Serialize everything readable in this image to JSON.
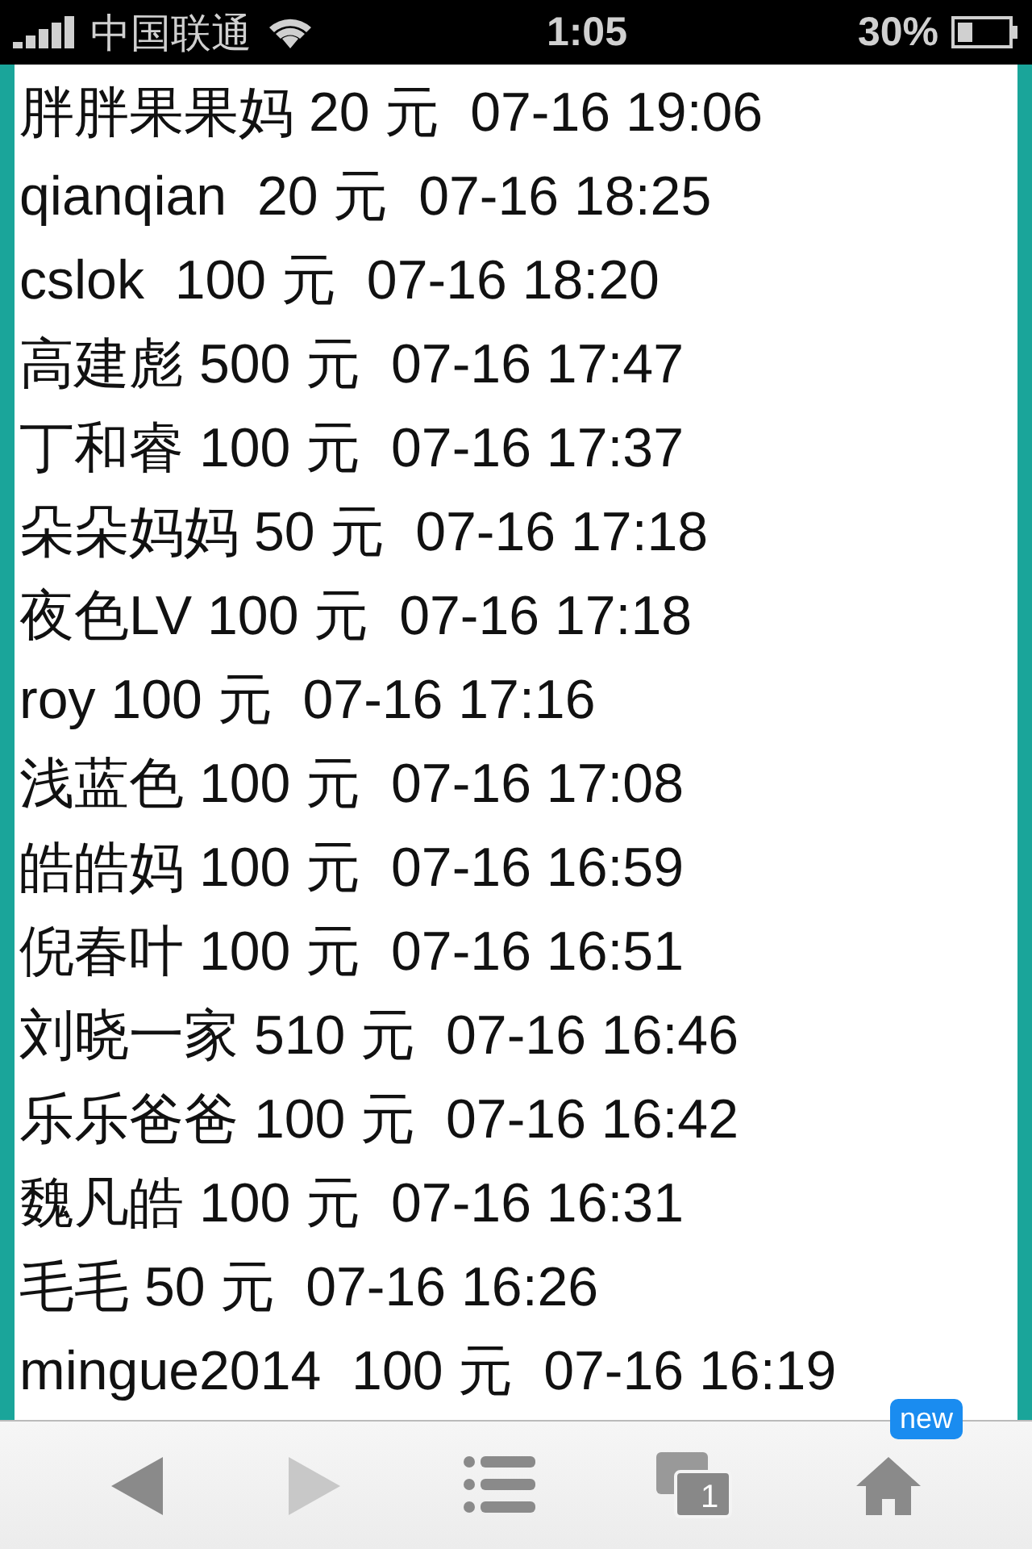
{
  "status_bar": {
    "carrier": "中国联通",
    "time": "1:05",
    "battery": "30%"
  },
  "entries": [
    {
      "text": "胖胖果果妈 20 元  07-16 19:06"
    },
    {
      "text": "qianqian  20 元  07-16 18:25"
    },
    {
      "text": "cslok  100 元  07-16 18:20"
    },
    {
      "text": "高建彪 500 元  07-16 17:47"
    },
    {
      "text": "丁和睿 100 元  07-16 17:37"
    },
    {
      "text": "朵朵妈妈 50 元  07-16 17:18"
    },
    {
      "text": "夜色LV 100 元  07-16 17:18"
    },
    {
      "text": "roy 100 元  07-16 17:16"
    },
    {
      "text": "浅蓝色 100 元  07-16 17:08"
    },
    {
      "text": "皓皓妈 100 元  07-16 16:59"
    },
    {
      "text": "倪春叶 100 元  07-16 16:51"
    },
    {
      "text": "刘晓一家 510 元  07-16 16:46"
    },
    {
      "text": "乐乐爸爸 100 元  07-16 16:42"
    },
    {
      "text": "魏凡皓 100 元  07-16 16:31"
    },
    {
      "text": "毛毛 50 元  07-16 16:26"
    },
    {
      "text": "mingue2014  100 元  07-16 16:19"
    }
  ],
  "toolbar": {
    "back_disabled": false,
    "forward_disabled": true,
    "tab_count": "1",
    "badge": "new"
  }
}
